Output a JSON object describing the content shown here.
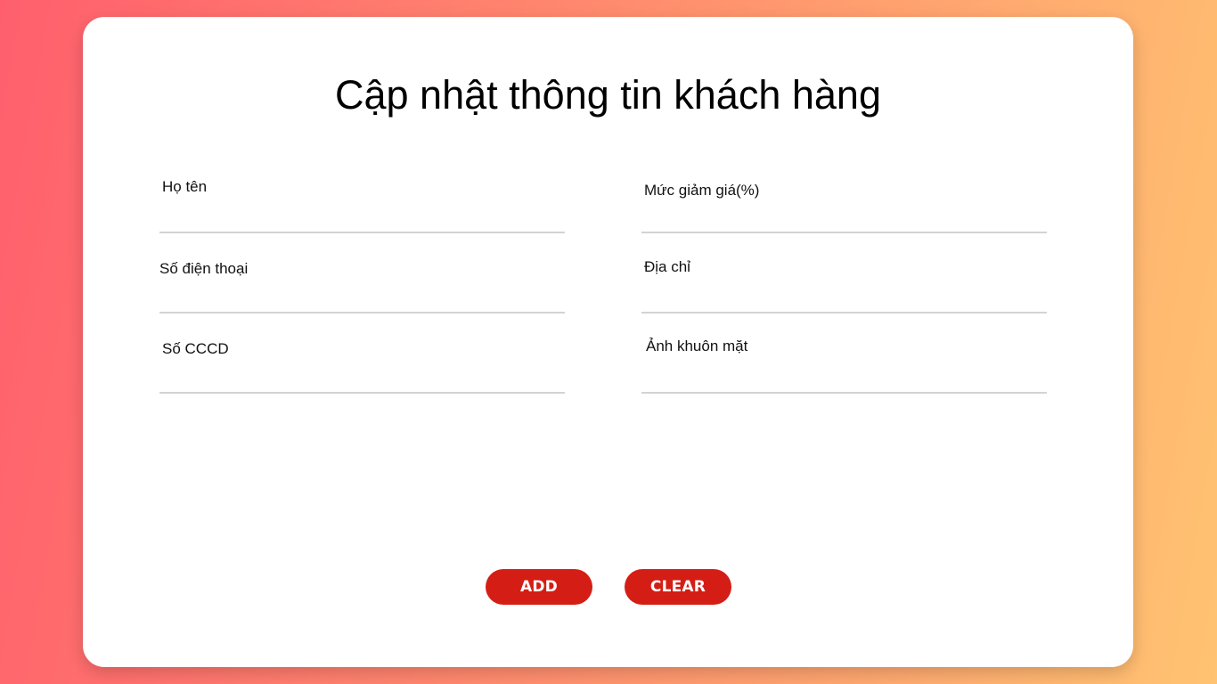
{
  "form": {
    "title": "Cập nhật thông tin khách hàng",
    "fields": [
      {
        "label": "Họ tên",
        "value": ""
      },
      {
        "label": "Mức giảm giá(%)",
        "value": ""
      },
      {
        "label": "Số điện thoại",
        "value": ""
      },
      {
        "label": "Địa chỉ",
        "value": ""
      },
      {
        "label": "Số CCCD",
        "value": ""
      },
      {
        "label": "Ảnh khuôn mặt",
        "value": ""
      }
    ],
    "buttons": {
      "add_label": "ADD",
      "clear_label": "CLEAR"
    }
  },
  "colors": {
    "accent": "#d41e15",
    "background_start": "#ff5f6d",
    "background_end": "#ffc371",
    "underline": "#d3d3d3"
  }
}
